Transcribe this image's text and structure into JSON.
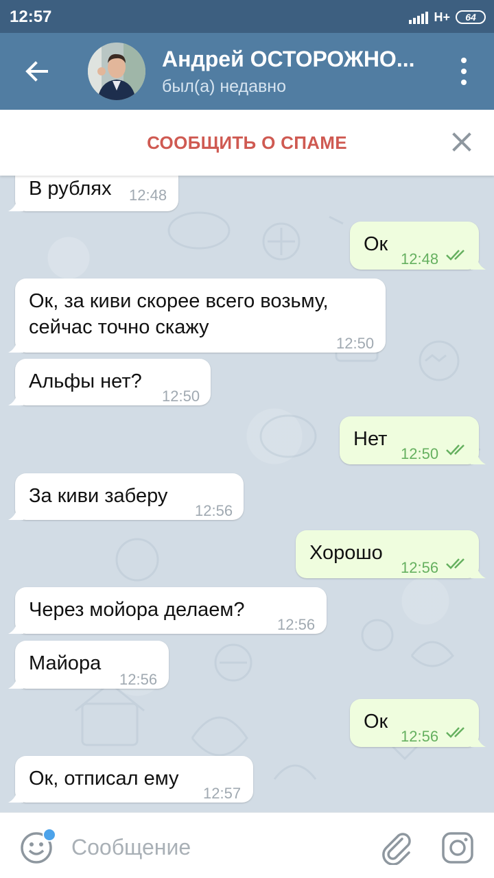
{
  "status": {
    "time": "12:57",
    "network": "H+",
    "battery": "64"
  },
  "header": {
    "back_icon": "arrow-left-icon",
    "contact_name": "Андрей ОСТОРОЖНО...",
    "last_seen": "был(а) недавно",
    "menu_icon": "more-vertical-icon"
  },
  "spam_bar": {
    "label": "СООБЩИТЬ О СПАМЕ",
    "close_icon": "close-icon"
  },
  "messages": [
    {
      "dir": "in",
      "text": "В рублях",
      "time": "12:48"
    },
    {
      "dir": "out",
      "text": "Ок",
      "time": "12:48",
      "read": true
    },
    {
      "dir": "in",
      "text": "Ок, за киви скорее всего возьму,",
      "text2": "сейчас точно скажу",
      "time": "12:50"
    },
    {
      "dir": "in",
      "text": "Альфы нет?",
      "time": "12:50"
    },
    {
      "dir": "out",
      "text": "Нет",
      "time": "12:50",
      "read": true
    },
    {
      "dir": "in",
      "text": "За киви заберу",
      "time": "12:56"
    },
    {
      "dir": "out",
      "text": "Хорошо",
      "time": "12:56",
      "read": true
    },
    {
      "dir": "in",
      "text": "Через мойора делаем?",
      "time": "12:56"
    },
    {
      "dir": "in",
      "text": "Майора",
      "time": "12:56"
    },
    {
      "dir": "out",
      "text": "Ок",
      "time": "12:56",
      "read": true
    },
    {
      "dir": "in",
      "text": "Ок, отписал ему",
      "time": "12:57"
    }
  ],
  "composer": {
    "placeholder": "Сообщение",
    "emoji_icon": "emoji-icon",
    "attach_icon": "paperclip-icon",
    "camera_icon": "camera-icon"
  },
  "colors": {
    "statusbar": "#3d5f80",
    "appbar": "#517da2",
    "spam": "#cf5a52",
    "outgoing_bubble": "#effdde",
    "outgoing_time": "#65b05f",
    "chat_bg": "#d2dce5"
  }
}
